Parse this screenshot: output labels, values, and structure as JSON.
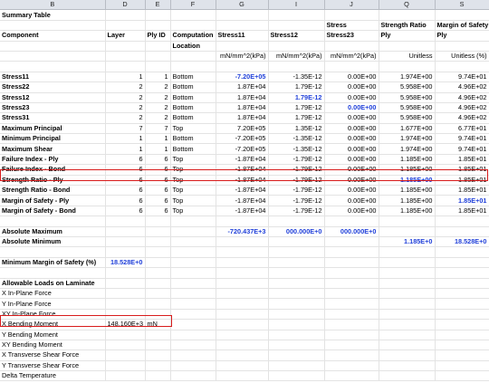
{
  "columns": [
    "B",
    "D",
    "E",
    "F",
    "G",
    "I",
    "J",
    "Q",
    "S"
  ],
  "title": "Summary Table",
  "header": {
    "row1": [
      "",
      "",
      "",
      "",
      "",
      "",
      "Stress",
      "Strength Ratio",
      "Margin of Safety"
    ],
    "row2": [
      "Component",
      "Layer",
      "Ply ID",
      "Computation",
      "Stress11",
      "Stress12",
      "Stress23",
      "Ply",
      "Ply"
    ],
    "row3": [
      "",
      "",
      "",
      "Location",
      "",
      "",
      "",
      "",
      ""
    ],
    "units": [
      "",
      "",
      "",
      "",
      "mN/mm^2(kPa)",
      "mN/mm^2(kPa)",
      "mN/mm^2(kPa)",
      "Unitless",
      "Unitless (%)"
    ]
  },
  "rows": [
    [
      "Stress11",
      "1",
      "1",
      "Bottom",
      "-7.20E+05",
      "-1.35E-12",
      "0.00E+00",
      "1.974E+00",
      "9.74E+01"
    ],
    [
      "Stress22",
      "2",
      "2",
      "Bottom",
      "1.87E+04",
      "1.79E-12",
      "0.00E+00",
      "5.958E+00",
      "4.96E+02"
    ],
    [
      "Stress12",
      "2",
      "2",
      "Bottom",
      "1.87E+04",
      "1.79E-12",
      "0.00E+00",
      "5.958E+00",
      "4.96E+02"
    ],
    [
      "Stress23",
      "2",
      "2",
      "Bottom",
      "1.87E+04",
      "1.79E-12",
      "0.00E+00",
      "5.958E+00",
      "4.96E+02"
    ],
    [
      "Stress31",
      "2",
      "2",
      "Bottom",
      "1.87E+04",
      "1.79E-12",
      "0.00E+00",
      "5.958E+00",
      "4.96E+02"
    ],
    [
      "Maximum Principal",
      "7",
      "7",
      "Top",
      "7.20E+05",
      "1.35E-12",
      "0.00E+00",
      "1.677E+00",
      "6.77E+01"
    ],
    [
      "Minimum Principal",
      "1",
      "1",
      "Bottom",
      "-7.20E+05",
      "-1.35E-12",
      "0.00E+00",
      "1.974E+00",
      "9.74E+01"
    ],
    [
      "Maximum Shear",
      "1",
      "1",
      "Bottom",
      "-7.20E+05",
      "-1.35E-12",
      "0.00E+00",
      "1.974E+00",
      "9.74E+01"
    ],
    [
      "Failure Index - Ply",
      "6",
      "6",
      "Top",
      "-1.87E+04",
      "-1.79E-12",
      "0.00E+00",
      "1.185E+00",
      "1.85E+01"
    ],
    [
      "Failure Index - Bond",
      "6",
      "6",
      "Top",
      "-1.87E+04",
      "-1.79E-12",
      "0.00E+00",
      "1.185E+00",
      "1.85E+01"
    ],
    [
      "Strength Ratio - Ply",
      "6",
      "6",
      "Top",
      "-1.87E+04",
      "-1.79E-12",
      "0.00E+00",
      "1.185E+00",
      "1.85E+01"
    ],
    [
      "Strength Ratio - Bond",
      "6",
      "6",
      "Top",
      "-1.87E+04",
      "-1.79E-12",
      "0.00E+00",
      "1.185E+00",
      "1.85E+01"
    ],
    [
      "Margin of Safety - Ply",
      "6",
      "6",
      "Top",
      "-1.87E+04",
      "-1.79E-12",
      "0.00E+00",
      "1.185E+00",
      "1.85E+01"
    ],
    [
      "Margin of Safety - Bond",
      "6",
      "6",
      "Top",
      "-1.87E+04",
      "-1.79E-12",
      "0.00E+00",
      "1.185E+00",
      "1.85E+01"
    ]
  ],
  "abs_max": {
    "label": "Absolute Maximum",
    "g": "-720.437E+3",
    "i": "000.000E+0",
    "j": "000.000E+0"
  },
  "abs_min": {
    "label": "Absolute Minimum",
    "q": "1.185E+0",
    "s": "18.528E+0"
  },
  "min_margin": {
    "label": "Minimum Margin of Safety (%)",
    "value": "18.528E+0"
  },
  "loads": {
    "title": "Allowable Loads on Laminate",
    "items": [
      "X In-Plane Force",
      "Y In-Plane Force",
      "XY In-Plane Force",
      "X Bending Moment",
      "Y Bending Moment",
      "XY Bending Moment",
      "X Transverse Shear Force",
      "Y Transverse Shear Force",
      "Delta Temperature"
    ],
    "x_bending_value": "148.160E+3",
    "x_bending_unit": "mN"
  }
}
